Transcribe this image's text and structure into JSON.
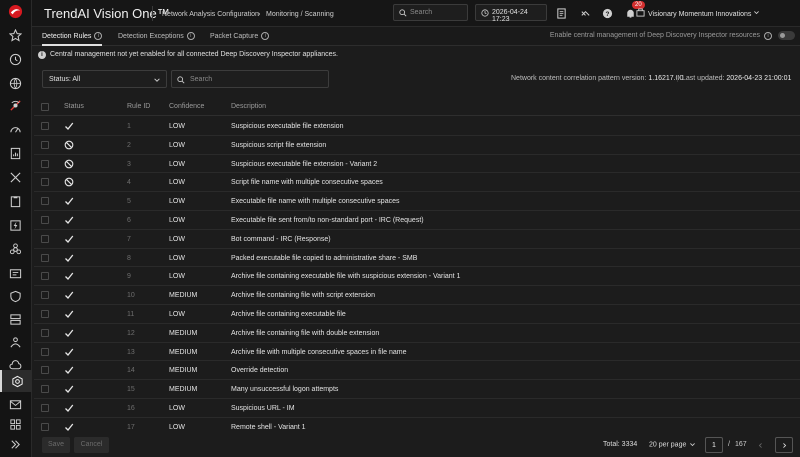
{
  "app": {
    "title": "TrendAI Vision One™",
    "breadcrumb_parent": "Network Analysis Configuration",
    "breadcrumb_sep": "›",
    "breadcrumb_current": "Monitoring / Scanning",
    "search_placeholder": "Search",
    "datetime": "2026-04-24 17:23",
    "notification_count": "20",
    "organization": "Visionary Momentum Innovations"
  },
  "tabs": [
    {
      "label": "Detection Rules",
      "active": true
    },
    {
      "label": "Detection Exceptions",
      "active": false
    },
    {
      "label": "Packet Capture",
      "active": false
    }
  ],
  "central_management": {
    "label": "Enable central management of Deep Discovery Inspector resources",
    "enabled": false
  },
  "notice": "Central management not yet enabled for all connected Deep Discovery Inspector appliances.",
  "filters": {
    "status_label": "Status: All",
    "search_placeholder": "Search"
  },
  "meta": {
    "pattern_label": "Network content correlation pattern version:",
    "pattern_value": "1.16217.00",
    "updated_label": "Last updated:",
    "updated_value": "2026-04-23 21:00:01"
  },
  "table": {
    "headers": {
      "status": "Status",
      "rule_id": "Rule ID",
      "confidence": "Confidence",
      "description": "Description"
    },
    "rows": [
      {
        "status": "enabled",
        "id": "1",
        "confidence": "LOW",
        "description": "Suspicious executable file extension"
      },
      {
        "status": "disabled",
        "id": "2",
        "confidence": "LOW",
        "description": "Suspicious script file extension"
      },
      {
        "status": "disabled",
        "id": "3",
        "confidence": "LOW",
        "description": "Suspicious executable file extension - Variant 2"
      },
      {
        "status": "disabled",
        "id": "4",
        "confidence": "LOW",
        "description": "Script file name with multiple consecutive spaces"
      },
      {
        "status": "enabled",
        "id": "5",
        "confidence": "LOW",
        "description": "Executable file name with multiple consecutive spaces"
      },
      {
        "status": "enabled",
        "id": "6",
        "confidence": "LOW",
        "description": "Executable file sent from/to non-standard port - IRC (Request)"
      },
      {
        "status": "enabled",
        "id": "7",
        "confidence": "LOW",
        "description": "Bot command - IRC (Response)"
      },
      {
        "status": "enabled",
        "id": "8",
        "confidence": "LOW",
        "description": "Packed executable file copied to administrative share - SMB"
      },
      {
        "status": "enabled",
        "id": "9",
        "confidence": "LOW",
        "description": "Archive file containing executable file with suspicious extension - Variant 1"
      },
      {
        "status": "enabled",
        "id": "10",
        "confidence": "MEDIUM",
        "description": "Archive file containing file with script extension"
      },
      {
        "status": "enabled",
        "id": "11",
        "confidence": "LOW",
        "description": "Archive file containing executable file"
      },
      {
        "status": "enabled",
        "id": "12",
        "confidence": "MEDIUM",
        "description": "Archive file containing file with double extension"
      },
      {
        "status": "enabled",
        "id": "13",
        "confidence": "MEDIUM",
        "description": "Archive file with multiple consecutive spaces in file name"
      },
      {
        "status": "enabled",
        "id": "14",
        "confidence": "MEDIUM",
        "description": "Override detection"
      },
      {
        "status": "enabled",
        "id": "15",
        "confidence": "MEDIUM",
        "description": "Many unsuccessful logon attempts"
      },
      {
        "status": "enabled",
        "id": "16",
        "confidence": "LOW",
        "description": "Suspicious URL - IM"
      },
      {
        "status": "enabled",
        "id": "17",
        "confidence": "LOW",
        "description": "Remote shell - Variant 1"
      }
    ]
  },
  "footer": {
    "save_label": "Save",
    "cancel_label": "Cancel",
    "total": "Total: 3334",
    "per_page": "20 per page",
    "current_page": "1",
    "page_sep": "/",
    "total_pages": "167"
  }
}
